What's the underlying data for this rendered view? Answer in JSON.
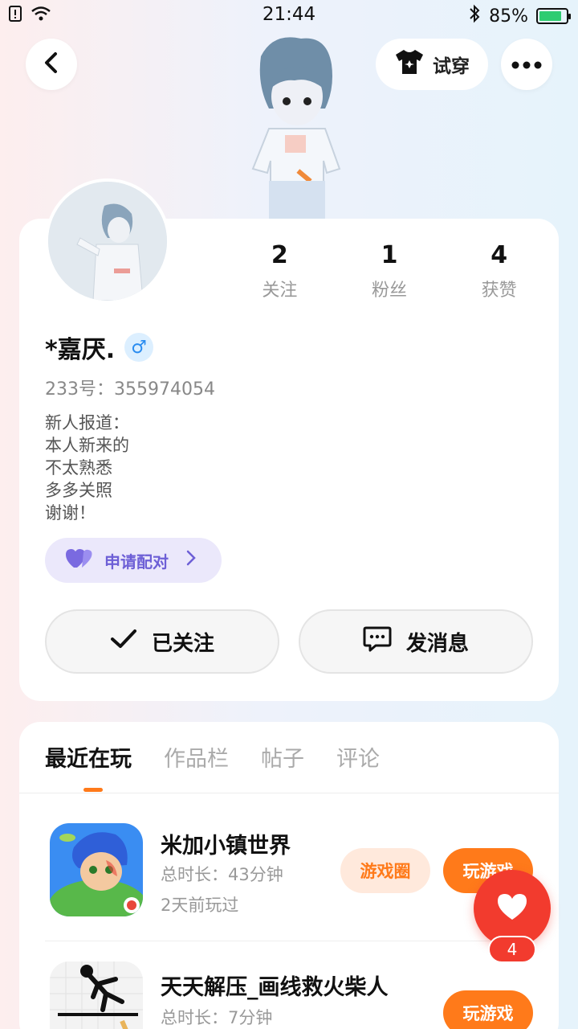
{
  "status_bar": {
    "time": "21:44",
    "battery": "85%"
  },
  "header": {
    "tryon_label": "试穿"
  },
  "profile": {
    "stats": [
      {
        "value": "2",
        "label": "关注"
      },
      {
        "value": "1",
        "label": "粉丝"
      },
      {
        "value": "4",
        "label": "获赞"
      }
    ],
    "username": "*嘉厌.",
    "gender_symbol": "♂",
    "uid": "233号：355974054",
    "bio_lines": [
      "新人报道：",
      "本人新来的",
      "不太熟悉",
      "多多关照",
      "谢谢！"
    ],
    "pair_label": "申请配对",
    "follow_label": "已关注",
    "message_label": "发消息"
  },
  "tabs": [
    "最近在玩",
    "作品栏",
    "帖子",
    "评论"
  ],
  "games": [
    {
      "title": "米加小镇世界",
      "duration": "总时长：43分钟",
      "last_played": "2天前玩过",
      "circle_label": "游戏圈",
      "play_label": "玩游戏"
    },
    {
      "title": "天天解压_画线救火柴人",
      "duration": "总时长：7分钟",
      "play_label": "玩游戏"
    }
  ],
  "like_count": "4",
  "colors": {
    "accent": "#ff7a1a",
    "like": "#f23b2e",
    "pair": "#6d5fd6"
  }
}
